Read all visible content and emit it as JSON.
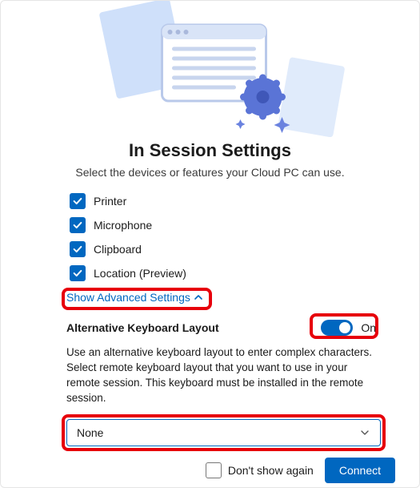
{
  "title": "In Session Settings",
  "subtitle": "Select the devices or features your Cloud PC can use.",
  "devices": {
    "printer": "Printer",
    "microphone": "Microphone",
    "clipboard": "Clipboard",
    "location": "Location (Preview)"
  },
  "advanced_link": "Show Advanced Settings",
  "alt_kb": {
    "label": "Alternative Keyboard Layout",
    "toggle_state": "On",
    "description": "Use an alternative keyboard layout to enter complex characters. Select remote keyboard layout that you want to use in your remote session. This keyboard must be installed in the remote session.",
    "selected": "None"
  },
  "footer": {
    "dont_show": "Don't show again",
    "connect": "Connect"
  }
}
